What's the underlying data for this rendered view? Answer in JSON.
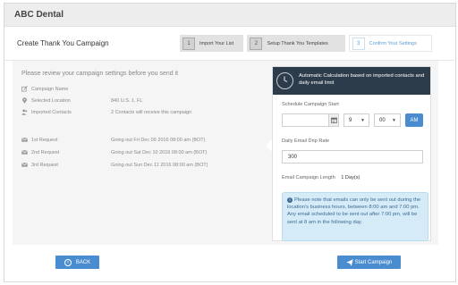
{
  "app": {
    "title": "ABC Dental"
  },
  "page": {
    "title": "Create Thank You Campaign"
  },
  "steps": [
    {
      "num": "1",
      "label": "Import Your List"
    },
    {
      "num": "2",
      "label": "Setup Thank You Templates"
    },
    {
      "num": "3",
      "label": "Confirm Your Settings"
    }
  ],
  "summary": {
    "intro": "Please review your campaign settings before you send it",
    "campaign_name_label": "Campaign Name",
    "campaign_name_value": "",
    "location_label": "Selected Location",
    "location_value": "840 U.S. 1, FL",
    "contacts_label": "Imported Contacts",
    "contacts_value": "2 Contacts will receive this campaign",
    "requests": [
      {
        "label": "1st Request",
        "value": "Going out Fri Dec 09 2016 08:00 am (BOT)"
      },
      {
        "label": "2nd Request",
        "value": "Going out Sat Dec 10 2016 08:00 am (BOT)"
      },
      {
        "label": "3rd Request",
        "value": "Going out Sun Dec 11 2016 08:00 am (BOT)"
      }
    ]
  },
  "calc": {
    "heading": "Automatic Calculation based on imported contacts and daily email limit",
    "schedule_label": "Schedule Campaign Start",
    "date_value": "",
    "hour": "9",
    "minute": "00",
    "ampm": "AM",
    "drip_label": "Daily Email Drip Rate",
    "drip_value": "300",
    "length_label": "Email Campaign Length",
    "length_value": "1 Day(s)",
    "note": "Please note that emails can only be sent out during the location's business hours, between 8:00 am and 7:00 pm. Any email scheduled to be sent out after 7:00 pm, will be sent at 8 am in the following day."
  },
  "buttons": {
    "back": "BACK",
    "start": "Start Campaign"
  },
  "colors": {
    "accent": "#4a8cd0",
    "calc_header": "#2d3c4a",
    "note_bg": "#d6ebf8"
  }
}
